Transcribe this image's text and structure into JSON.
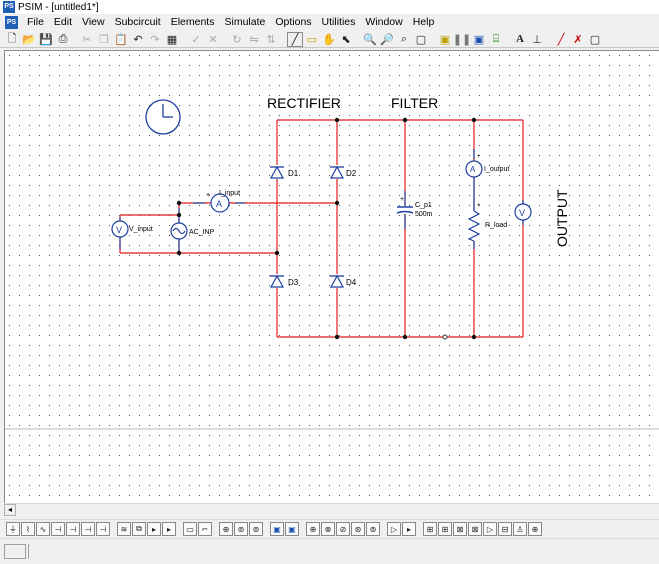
{
  "window": {
    "title": "PSIM - [untitled1*]"
  },
  "menu": {
    "items": [
      "File",
      "Edit",
      "View",
      "Subcircuit",
      "Elements",
      "Simulate",
      "Options",
      "Utilities",
      "Window",
      "Help"
    ]
  },
  "toolbar": {
    "buttons": [
      "new-icon",
      "open-icon",
      "save-icon",
      "print-icon",
      "cut-icon",
      "copy-icon",
      "paste-icon",
      "undo-icon",
      "redo-icon",
      "paste-special-icon",
      "check-icon",
      "escape-icon",
      "rotate-icon",
      "flip-lr-icon",
      "flip-tb-icon",
      "wire-icon",
      "label-icon",
      "pan-icon",
      "select-icon",
      "zoom-in-icon",
      "zoom-out-icon",
      "zoom-fit-icon",
      "page-icon",
      "run-simulation-icon",
      "pause-icon",
      "simview-icon",
      "signal-icon",
      "text-icon",
      "probe-icon",
      "draw-line-icon",
      "draw-icon"
    ]
  },
  "schematic": {
    "labels": {
      "rectifier": "RECTIFIER",
      "filter": "FILTER",
      "output": "OUTPUT",
      "d1": "D1",
      "d2": "D2",
      "d3": "D3",
      "d4": "D4",
      "i_input": "I_input",
      "v_input": "V_input",
      "ac_inp": "AC_INP",
      "c_p1": "C_p1",
      "c_p1_value": "500m",
      "i_output": "I_output",
      "r_load": "R_load",
      "ammeter_symbol": "A"
    },
    "wire_color": "#ff0000",
    "grid_color": "#4a4a4a"
  },
  "elementbar": {
    "buttons": [
      "ground-icon",
      "resistor-icon",
      "inductor-icon",
      "capacitor-icon",
      "rl-icon",
      "rc-icon",
      "rlc-icon",
      "lc-icon",
      "transformer-icon",
      "switch-icon",
      "diode-icon",
      "thyristor-icon",
      "scr-icon",
      "mosfet-icon",
      "igbt-icon",
      "gto-icon",
      "triac-icon",
      "npn-icon",
      "pnp-icon",
      "opamp-icon",
      "comparator-icon",
      "limiter-icon",
      "sum-icon",
      "multiplier-icon",
      "divider-icon",
      "dc-source-icon",
      "ac-source-icon",
      "triangle-source-icon",
      "square-source-icon",
      "step-source-icon",
      "voltage-probe-icon",
      "current-probe-icon",
      "ammeter-icon",
      "voltmeter-icon",
      "wattmeter-icon",
      "label-icon",
      "node-icon",
      "ground2-icon",
      "port-icon",
      "meter-icon"
    ]
  }
}
